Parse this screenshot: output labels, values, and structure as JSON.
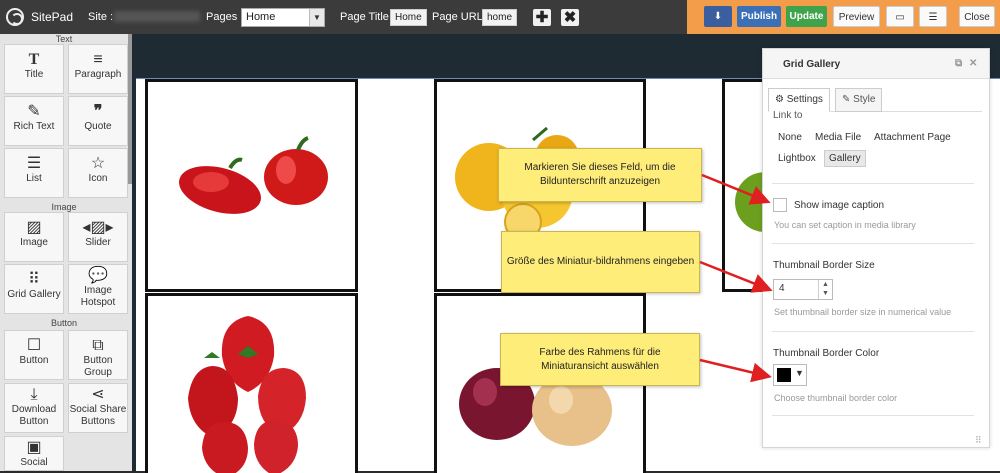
{
  "app": {
    "name": "SitePad"
  },
  "topbar": {
    "site_label": "Site :",
    "pages_label": "Pages :",
    "pages_value": "Home",
    "page_title_label": "Page Title :",
    "page_title_value": "Home",
    "page_url_label": "Page URL :",
    "page_url_value": "home",
    "add_icon": "plus-icon",
    "delete_icon": "x-icon",
    "publish": "Publish",
    "update": "Update",
    "preview": "Preview",
    "close": "Close"
  },
  "sidebar": {
    "sections": {
      "text": "Text",
      "image": "Image",
      "button": "Button"
    },
    "widgets": [
      {
        "label": "Title",
        "icon": "title-icon"
      },
      {
        "label": "Paragraph",
        "icon": "paragraph-icon"
      },
      {
        "label": "Rich Text",
        "icon": "edit-icon"
      },
      {
        "label": "Quote",
        "icon": "quote-icon"
      },
      {
        "label": "List",
        "icon": "list-icon"
      },
      {
        "label": "Icon",
        "icon": "star-icon"
      },
      {
        "label": "Image",
        "icon": "image-icon"
      },
      {
        "label": "Slider",
        "icon": "slider-icon"
      },
      {
        "label": "Grid Gallery",
        "icon": "grid-icon"
      },
      {
        "label": "Image Hotspot",
        "icon": "hotspot-icon"
      },
      {
        "label": "Button",
        "icon": "button-icon"
      },
      {
        "label": "Button Group",
        "icon": "button-group-icon"
      },
      {
        "label": "Download Button",
        "icon": "download-icon"
      },
      {
        "label": "Social Share Buttons",
        "icon": "share-icon"
      },
      {
        "label": "Social",
        "icon": "social-icon"
      }
    ]
  },
  "panel": {
    "title": "Grid Gallery",
    "tabs": [
      "Settings",
      "Style"
    ],
    "link_to_label": "Link to",
    "link_options": [
      "None",
      "Media File",
      "Attachment Page",
      "Lightbox",
      "Gallery"
    ],
    "link_selected": "Gallery",
    "show_caption_label": "Show image caption",
    "show_caption_checked": false,
    "show_caption_hint": "You can set caption in media library",
    "border_size_label": "Thumbnail Border Size",
    "border_size_value": "4",
    "border_size_hint": "Set thumbnail border size in numerical value",
    "border_color_label": "Thumbnail Border Color",
    "border_color_value": "#000000",
    "border_color_hint": "Choose thumbnail border color"
  },
  "callouts": [
    {
      "text": "Markieren Sie dieses Feld, um die Bildunterschrift anzuzeigen"
    },
    {
      "text": "Größe des Miniatur-bildrahmens eingeben"
    },
    {
      "text": "Farbe des Rahmens für die Miniaturansicht auswählen"
    }
  ],
  "colors": {
    "topbar": "#3b3b3b",
    "accent_orange": "#f39c4a",
    "publish": "#3b6fb6",
    "update": "#3fa34b",
    "callout": "#ffed7a",
    "arrow": "#e02020"
  }
}
